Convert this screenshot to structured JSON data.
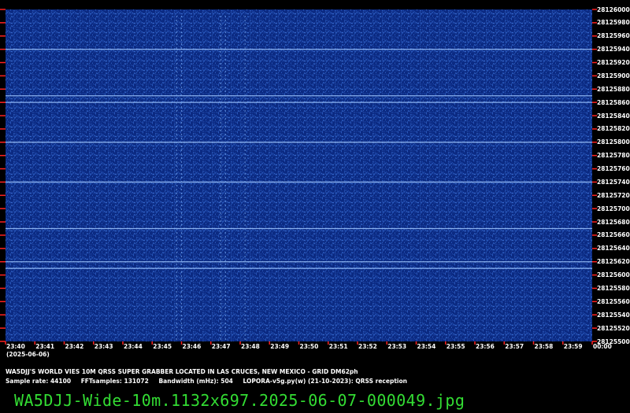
{
  "spectrogram": {
    "background_color": "#0b2a82",
    "signal_color": "#9ec6ff",
    "tick_color": "#ff2020",
    "frequency_labels": [
      "28126000",
      "28125980",
      "28125960",
      "28125940",
      "28125920",
      "28125900",
      "28125880",
      "28125860",
      "28125840",
      "28125820",
      "28125800",
      "28125780",
      "28125760",
      "28125740",
      "28125720",
      "28125700",
      "28125680",
      "28125660",
      "28125640",
      "28125620",
      "28125600",
      "28125580",
      "28125560",
      "28125540",
      "28125520",
      "28125500"
    ],
    "time_labels": [
      "23:40",
      "23:41",
      "23:42",
      "23:43",
      "23:44",
      "23:45",
      "23:46",
      "23:47",
      "23:48",
      "23:49",
      "23:50",
      "23:51",
      "23:52",
      "23:53",
      "23:54",
      "23:55",
      "23:56",
      "23:57",
      "23:58",
      "23:59",
      "00:00"
    ],
    "date": "(2025-06-06)",
    "carrier_frequencies": [
      28125940,
      28125870,
      28125860,
      28125800,
      28125740,
      28125670,
      28125620,
      28125610
    ],
    "vertical_signal_times": [
      "23:45:50",
      "23:46:00",
      "23:47:20",
      "23:47:30",
      "23:48:10"
    ]
  },
  "info": {
    "line1": "WA5DJJ'S WORLD VIES 10M QRSS SUPER GRABBER LOCATED IN LAS CRUCES, NEW MEXICO - GRID DM62ph",
    "sample_rate": "Sample rate: 44100",
    "fft_samples": "FFTsamples: 131072",
    "bandwidth": "Bandwidth (mHz): 504",
    "software": "LOPORA-v5g.py(w) (21-10-2023): QRSS reception"
  },
  "filename": "WA5DJJ-Wide-10m.1132x697.2025-06-07-000049.jpg"
}
